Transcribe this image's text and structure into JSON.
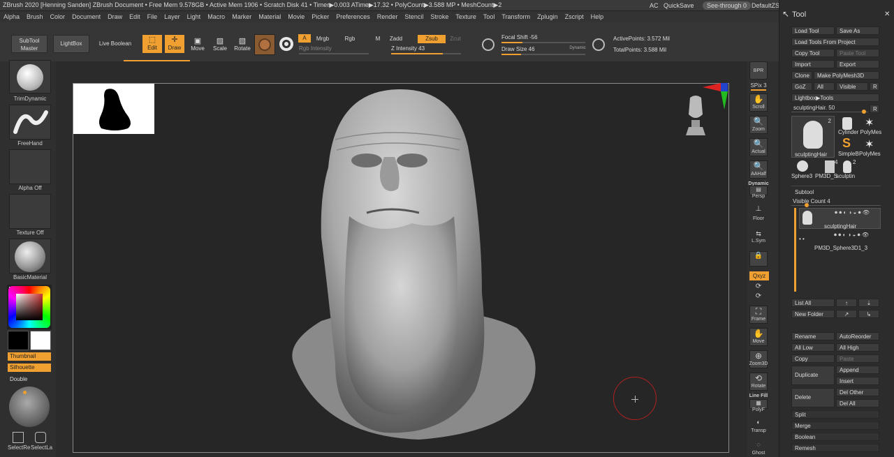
{
  "titlebar": {
    "segments": "ZBrush 2020 [Henning Sanden]   ZBrush Document   • Free Mem 9.578GB • Active Mem 1906 • Scratch Disk 41 • Timer▶0.003 ATime▶17.32 • PolyCount▶3.588 MP • MeshCount▶2",
    "ac": "AC",
    "quicksave": "QuickSave",
    "seethrough": "See-through  0",
    "defaultzscript": "DefaultZScript"
  },
  "menu": [
    "Alpha",
    "Brush",
    "Color",
    "Document",
    "Draw",
    "Edit",
    "File",
    "Layer",
    "Light",
    "Macro",
    "Marker",
    "Material",
    "Movie",
    "Picker",
    "Preferences",
    "Render",
    "Stencil",
    "Stroke",
    "Texture",
    "Tool",
    "Transform",
    "Zplugin",
    "Zscript",
    "Help"
  ],
  "toolbar": {
    "subtool_master": "SubTool Master",
    "lightbox": "LightBox",
    "live_boolean": "Live Boolean",
    "edit": "Edit",
    "draw": "Draw",
    "move": "Move",
    "scale": "Scale",
    "rotate": "Rotate",
    "a": "A",
    "mrgb": "Mrgb",
    "rgb": "Rgb",
    "m": "M",
    "zadd": "Zadd",
    "zsub": "Zsub",
    "zcut": "Zcut",
    "rgb_intensity": "Rgb Intensity",
    "z_intensity": "Z Intensity 43",
    "focal_shift": "Focal Shift -56",
    "draw_size": "Draw Size 46",
    "dynamic": "Dynamic",
    "active_points": "ActivePoints: 3.572 Mil",
    "total_points": "TotalPoints: 3.588 Mil"
  },
  "leftshelf": {
    "brush": "TrimDynamic",
    "stroke": "FreeHand",
    "alpha": "Alpha Off",
    "texture": "Texture Off",
    "material": "BasicMaterial",
    "thumbnail": "Thumbnail",
    "silhouette": "Silhouette",
    "double": "Double",
    "select_rect": "SelectRe",
    "select_lasso": "SelectLa"
  },
  "rightshelf": {
    "bpr": "BPR",
    "spix": "SPix 3",
    "scroll": "Scroll",
    "zoom": "Zoom",
    "actual": "Actual",
    "aahalf": "AAHalf",
    "dynamic": "Dynamic",
    "persp": "Persp",
    "floor": "Floor",
    "lsym": "L.Sym",
    "xyz": "Qxyz",
    "frame": "Frame",
    "move": "Move",
    "zoom3d": "Zoom3D",
    "rotate": "Rotate",
    "linefill": "Line Fill",
    "polyf": "PolyF",
    "transp": "Transp",
    "ghost": "Ghost"
  },
  "toolpanel": {
    "title": "Tool",
    "load_tool": "Load Tool",
    "save_as": "Save As",
    "load_from_project": "Load Tools From Project",
    "copy_tool": "Copy Tool",
    "paste_tool": "Paste Tool",
    "import": "Import",
    "export": "Export",
    "clone": "Clone",
    "make_polymesh": "Make PolyMesh3D",
    "goz": "GoZ",
    "all": "All",
    "visible": "Visible",
    "r": "R",
    "lightbox_tools": "Lightbox▶Tools",
    "current_tool": "sculptingHair. 50",
    "tool_thumbs": {
      "main_label": "sculptingHair",
      "main_count": "2",
      "cylinder": "Cylinder PolyMes",
      "simpleb": "SimpleB",
      "polymes": "PolyMes",
      "sphere": "Sphere3",
      "pm3d": "PM3D_S",
      "sculpt": "sculptin",
      "sculpt_count": "2",
      "pm3d_count": "4"
    },
    "subtool_title": "Subtool",
    "visible_count": "Visible Count 4",
    "subtools": [
      "sculptingHair",
      "PM3D_Sphere3D1_3"
    ],
    "list_all": "List All",
    "new_folder": "New Folder",
    "rename": "Rename",
    "autoreorder": "AutoReorder",
    "all_low": "All Low",
    "all_high": "All High",
    "copy": "Copy",
    "paste": "Paste",
    "append": "Append",
    "duplicate": "Duplicate",
    "insert": "Insert",
    "delete": "Delete",
    "del_other": "Del Other",
    "del_all": "Del All",
    "split": "Split",
    "merge": "Merge",
    "boolean": "Boolean",
    "remesh": "Remesh"
  },
  "colors": {
    "accent": "#f0a030",
    "bg": "#2b2b2b",
    "panel": "#2c2c2c",
    "cursor_ring": "#b02020"
  }
}
